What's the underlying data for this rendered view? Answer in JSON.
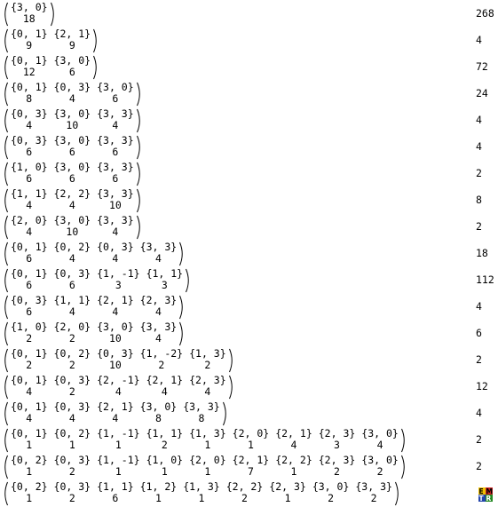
{
  "rows": [
    {
      "cols": [
        {
          "pair": "{3, 0}",
          "mult": "18"
        }
      ],
      "count": "268"
    },
    {
      "cols": [
        {
          "pair": "{0, 1}",
          "mult": "9"
        },
        {
          "pair": "{2, 1}",
          "mult": "9"
        }
      ],
      "count": "4"
    },
    {
      "cols": [
        {
          "pair": "{0, 1}",
          "mult": "12"
        },
        {
          "pair": "{3, 0}",
          "mult": "6"
        }
      ],
      "count": "72"
    },
    {
      "cols": [
        {
          "pair": "{0, 1}",
          "mult": "8"
        },
        {
          "pair": "{0, 3}",
          "mult": "4"
        },
        {
          "pair": "{3, 0}",
          "mult": "6"
        }
      ],
      "count": "24"
    },
    {
      "cols": [
        {
          "pair": "{0, 3}",
          "mult": "4"
        },
        {
          "pair": "{3, 0}",
          "mult": "10"
        },
        {
          "pair": "{3, 3}",
          "mult": "4"
        }
      ],
      "count": "4"
    },
    {
      "cols": [
        {
          "pair": "{0, 3}",
          "mult": "6"
        },
        {
          "pair": "{3, 0}",
          "mult": "6"
        },
        {
          "pair": "{3, 3}",
          "mult": "6"
        }
      ],
      "count": "4"
    },
    {
      "cols": [
        {
          "pair": "{1, 0}",
          "mult": "6"
        },
        {
          "pair": "{3, 0}",
          "mult": "6"
        },
        {
          "pair": "{3, 3}",
          "mult": "6"
        }
      ],
      "count": "2"
    },
    {
      "cols": [
        {
          "pair": "{1, 1}",
          "mult": "4"
        },
        {
          "pair": "{2, 2}",
          "mult": "4"
        },
        {
          "pair": "{3, 3}",
          "mult": "10"
        }
      ],
      "count": "8"
    },
    {
      "cols": [
        {
          "pair": "{2, 0}",
          "mult": "4"
        },
        {
          "pair": "{3, 0}",
          "mult": "10"
        },
        {
          "pair": "{3, 3}",
          "mult": "4"
        }
      ],
      "count": "2"
    },
    {
      "cols": [
        {
          "pair": "{0, 1}",
          "mult": "6"
        },
        {
          "pair": "{0, 2}",
          "mult": "4"
        },
        {
          "pair": "{0, 3}",
          "mult": "4"
        },
        {
          "pair": "{3, 3}",
          "mult": "4"
        }
      ],
      "count": "18"
    },
    {
      "cols": [
        {
          "pair": "{0, 1}",
          "mult": "6"
        },
        {
          "pair": "{0, 3}",
          "mult": "6"
        },
        {
          "pair": "{1, -1}",
          "mult": "3"
        },
        {
          "pair": "{1, 1}",
          "mult": "3"
        }
      ],
      "count": "112"
    },
    {
      "cols": [
        {
          "pair": "{0, 3}",
          "mult": "6"
        },
        {
          "pair": "{1, 1}",
          "mult": "4"
        },
        {
          "pair": "{2, 1}",
          "mult": "4"
        },
        {
          "pair": "{2, 3}",
          "mult": "4"
        }
      ],
      "count": "4"
    },
    {
      "cols": [
        {
          "pair": "{1, 0}",
          "mult": "2"
        },
        {
          "pair": "{2, 0}",
          "mult": "2"
        },
        {
          "pair": "{3, 0}",
          "mult": "10"
        },
        {
          "pair": "{3, 3}",
          "mult": "4"
        }
      ],
      "count": "6"
    },
    {
      "cols": [
        {
          "pair": "{0, 1}",
          "mult": "2"
        },
        {
          "pair": "{0, 2}",
          "mult": "2"
        },
        {
          "pair": "{0, 3}",
          "mult": "10"
        },
        {
          "pair": "{1, -2}",
          "mult": "2"
        },
        {
          "pair": "{1, 3}",
          "mult": "2"
        }
      ],
      "count": "2"
    },
    {
      "cols": [
        {
          "pair": "{0, 1}",
          "mult": "4"
        },
        {
          "pair": "{0, 3}",
          "mult": "2"
        },
        {
          "pair": "{2, -1}",
          "mult": "4"
        },
        {
          "pair": "{2, 1}",
          "mult": "4"
        },
        {
          "pair": "{2, 3}",
          "mult": "4"
        }
      ],
      "count": "12"
    },
    {
      "cols": [
        {
          "pair": "{0, 1}",
          "mult": "4"
        },
        {
          "pair": "{0, 3}",
          "mult": "4"
        },
        {
          "pair": "{2, 1}",
          "mult": "4"
        },
        {
          "pair": "{3, 0}",
          "mult": "8"
        },
        {
          "pair": "{3, 3}",
          "mult": "8"
        }
      ],
      "count": "4"
    },
    {
      "cols": [
        {
          "pair": "{0, 1}",
          "mult": "1"
        },
        {
          "pair": "{0, 2}",
          "mult": "1"
        },
        {
          "pair": "{1, -1}",
          "mult": "1"
        },
        {
          "pair": "{1, 1}",
          "mult": "2"
        },
        {
          "pair": "{1, 3}",
          "mult": "1"
        },
        {
          "pair": "{2, 0}",
          "mult": "1"
        },
        {
          "pair": "{2, 1}",
          "mult": "4"
        },
        {
          "pair": "{2, 3}",
          "mult": "3"
        },
        {
          "pair": "{3, 0}",
          "mult": "4"
        }
      ],
      "count": "2"
    },
    {
      "cols": [
        {
          "pair": "{0, 2}",
          "mult": "1"
        },
        {
          "pair": "{0, 3}",
          "mult": "2"
        },
        {
          "pair": "{1, -1}",
          "mult": "1"
        },
        {
          "pair": "{1, 0}",
          "mult": "1"
        },
        {
          "pair": "{2, 0}",
          "mult": "1"
        },
        {
          "pair": "{2, 1}",
          "mult": "7"
        },
        {
          "pair": "{2, 2}",
          "mult": "1"
        },
        {
          "pair": "{2, 3}",
          "mult": "2"
        },
        {
          "pair": "{3, 0}",
          "mult": "2"
        }
      ],
      "count": "2"
    },
    {
      "cols": [
        {
          "pair": "{0, 2}",
          "mult": "1"
        },
        {
          "pair": "{0, 3}",
          "mult": "2"
        },
        {
          "pair": "{1, 1}",
          "mult": "6"
        },
        {
          "pair": "{1, 2}",
          "mult": "1"
        },
        {
          "pair": "{1, 3}",
          "mult": "1"
        },
        {
          "pair": "{2, 2}",
          "mult": "2"
        },
        {
          "pair": "{2, 3}",
          "mult": "1"
        },
        {
          "pair": "{3, 0}",
          "mult": "2"
        },
        {
          "pair": "{3, 3}",
          "mult": "2"
        }
      ],
      "count": ""
    }
  ],
  "logo": {
    "icon": "mathematica-logo-icon",
    "text": "EM TRI",
    "colors": {
      "red": "#cc2222",
      "blue": "#2244aa",
      "yellow": "#f2c200",
      "green": "#228822"
    }
  }
}
